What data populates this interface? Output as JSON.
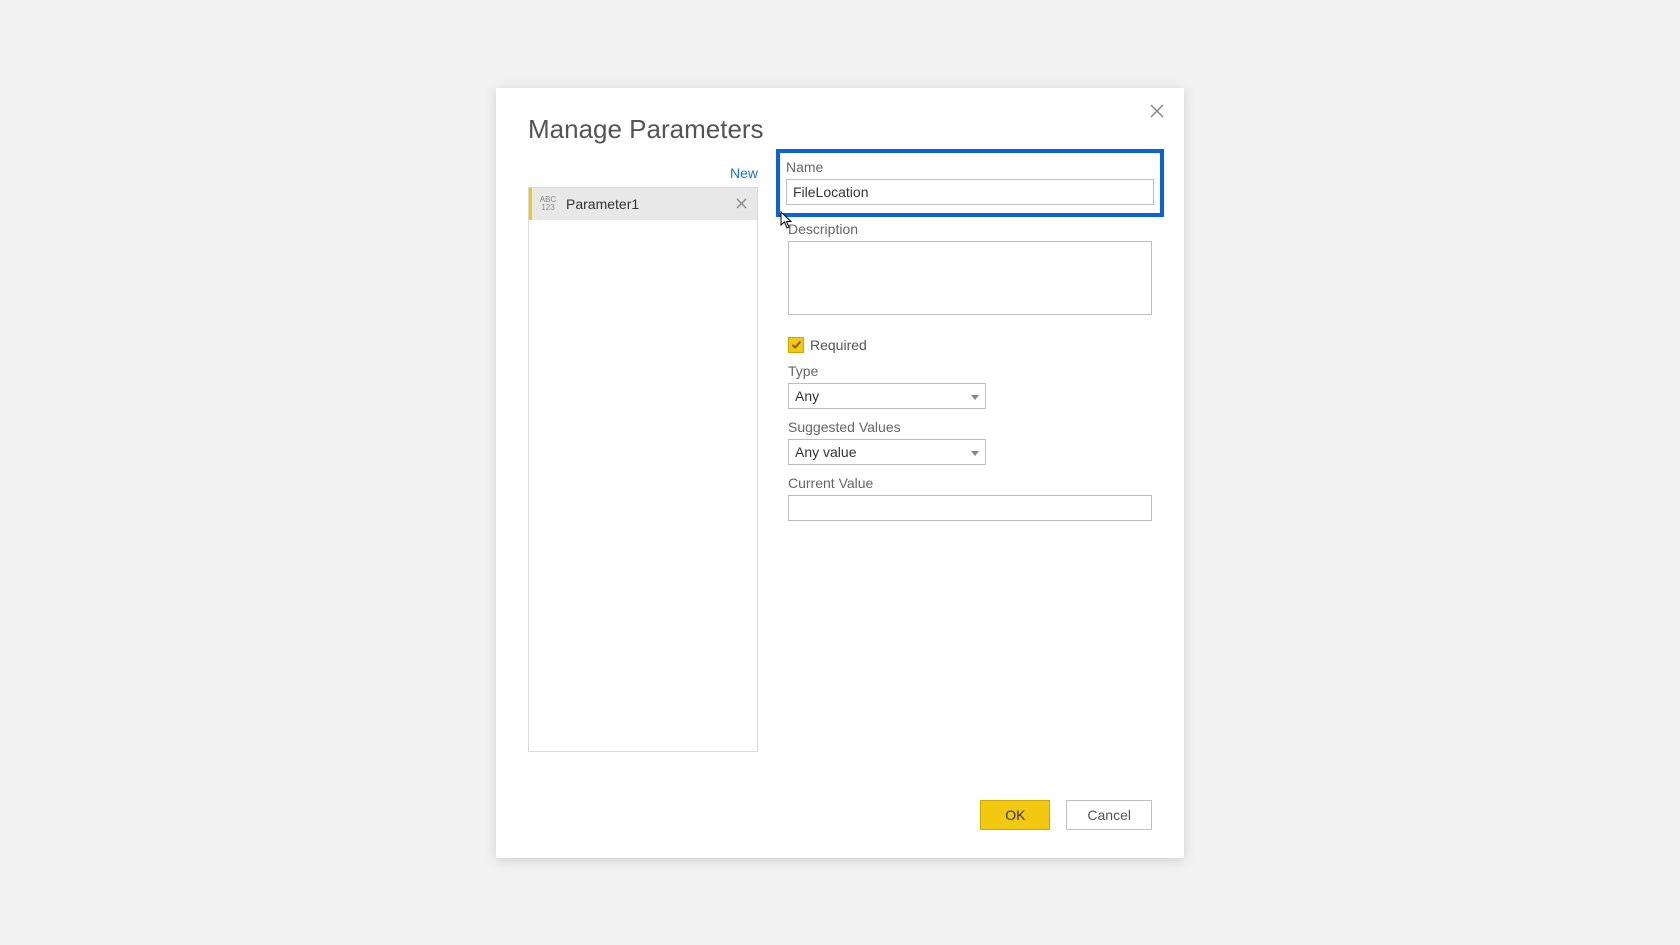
{
  "dialog": {
    "title": "Manage Parameters",
    "new_label": "New"
  },
  "params": {
    "items": [
      {
        "label": "Parameter1"
      }
    ]
  },
  "form": {
    "name_label": "Name",
    "name_value": "FileLocation",
    "description_label": "Description",
    "description_value": "",
    "required_label": "Required",
    "required_checked": true,
    "type_label": "Type",
    "type_value": "Any",
    "suggested_label": "Suggested Values",
    "suggested_value": "Any value",
    "current_label": "Current Value",
    "current_value": ""
  },
  "footer": {
    "ok_label": "OK",
    "cancel_label": "Cancel"
  }
}
